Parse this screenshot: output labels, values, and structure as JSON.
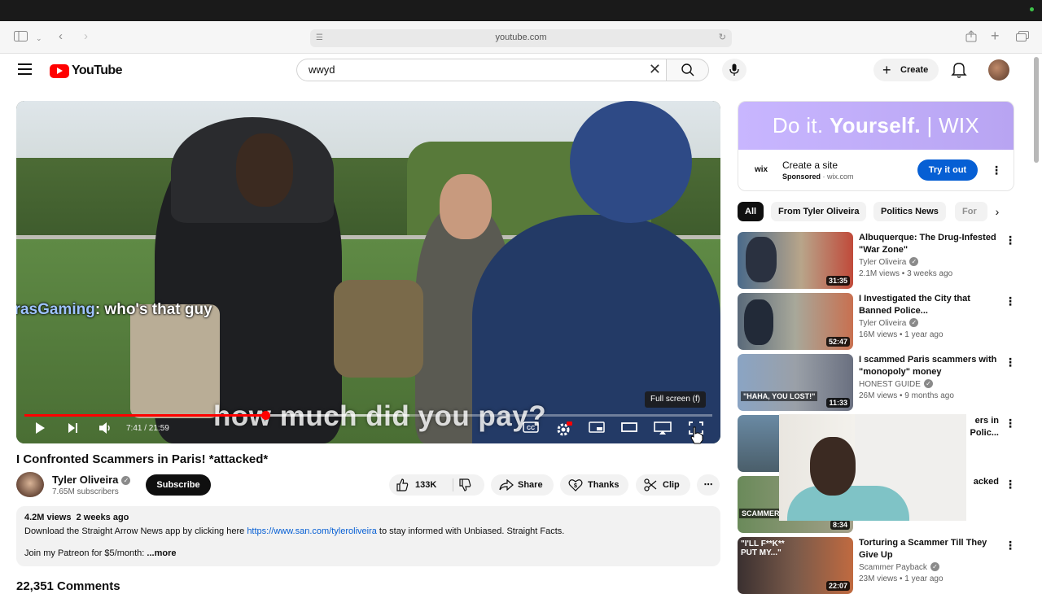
{
  "browser": {
    "url": "youtube.com"
  },
  "header": {
    "logo_text": "YouTube",
    "search_value": "wwyd",
    "create_label": "Create"
  },
  "player": {
    "chat_name": "TrasGaming",
    "chat_message": ": who's that guy",
    "caption": "how much did you pay?",
    "tooltip": "Full screen (f)",
    "time": "7:41 / 21:59",
    "progress_fraction": 0.35,
    "buffered_fraction": 0.56
  },
  "video": {
    "title": "I Confronted Scammers in Paris! *attacked*",
    "channel": "Tyler Oliveira",
    "subscribers": "7.65M subscribers",
    "subscribe_label": "Subscribe",
    "likes": "133K",
    "share_label": "Share",
    "thanks_label": "Thanks",
    "clip_label": "Clip"
  },
  "description": {
    "meta": "4.2M views  2 weeks ago",
    "line1_pre": "Download the Straight Arrow News app by clicking here ",
    "link": "https://www.san.com/tyleroliveira",
    "line1_post": " to stay informed with Unbiased. Straight Facts.",
    "line2": "Join my Patreon for $5/month:",
    "more": " ...more"
  },
  "comments": {
    "count_label": "22,351 Comments"
  },
  "ad": {
    "banner_pre": "Do it. ",
    "banner_bold": "Yourself.",
    "banner_post": " | WIX",
    "brand": "WIX",
    "title": "Create a site",
    "sponsored": "Sponsored",
    "domain": " · wix.com",
    "cta": "Try it out"
  },
  "chips": [
    "All",
    "From Tyler Oliveira",
    "Politics News",
    "For"
  ],
  "recommendations": [
    {
      "title": "Albuquerque: The Drug-Infested \"War Zone\"",
      "channel": "Tyler Oliveira",
      "views": "2.1M views • 3 weeks ago",
      "duration": "31:35"
    },
    {
      "title": "I Investigated the City that Banned Police...",
      "channel": "Tyler Oliveira",
      "views": "16M views • 1 year ago",
      "duration": "52:47"
    },
    {
      "title": "I scammed Paris scammers with \"monopoly\" money",
      "channel": "HONEST GUIDE",
      "views": "26M views • 9 months ago",
      "duration": "11:33",
      "thumb_text": "\"HAHA, YOU LOST!\""
    },
    {
      "title": "ers in Polic...",
      "channel": "",
      "views": "",
      "duration": ""
    },
    {
      "title": "acked",
      "channel": "",
      "views": "",
      "duration": "8:34",
      "thumb_text": "SCAMMER G"
    },
    {
      "title": "Torturing a Scammer Till They Give Up",
      "channel": "Scammer Payback",
      "views": "23M views • 1 year ago",
      "duration": "22:07",
      "thumb_text": "\"I'LL F**K** PUT MY...\""
    }
  ],
  "colors": {
    "brand_red": "#ff0000",
    "link_blue": "#065fd4",
    "wix_purple": "#b8a4f2"
  }
}
